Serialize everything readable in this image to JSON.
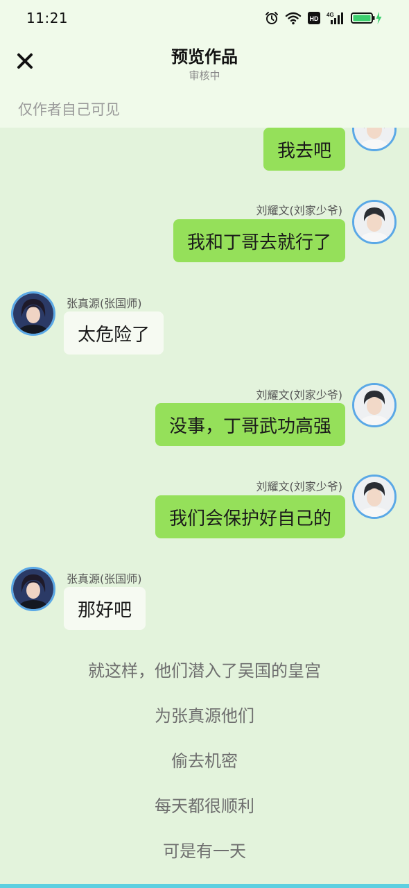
{
  "status_bar": {
    "time": "11:21",
    "icons": [
      "alarm-icon",
      "wifi-icon",
      "hd-icon",
      "signal-4g-icon",
      "battery-charging-icon"
    ],
    "battery_color": "#3ccf6e"
  },
  "header": {
    "title": "预览作品",
    "subtitle": "审核中",
    "close_icon": "close-icon"
  },
  "visibility_note": "仅作者自己可见",
  "colors": {
    "background": "#e3f3dc",
    "header_background": "#f0faea",
    "right_bubble": "#95e05a",
    "left_bubble": "#f6faf2",
    "avatar_border": "#5aa8e6",
    "bottom_strip": "#5ccfe0"
  },
  "messages": [
    {
      "side": "right",
      "sender": "",
      "text": "我去吧"
    },
    {
      "side": "right",
      "sender": "刘耀文(刘家少爷)",
      "text": "我和丁哥去就行了"
    },
    {
      "side": "left",
      "sender": "张真源(张国师)",
      "text": "太危险了"
    },
    {
      "side": "right",
      "sender": "刘耀文(刘家少爷)",
      "text": "没事，丁哥武功高强"
    },
    {
      "side": "right",
      "sender": "刘耀文(刘家少爷)",
      "text": "我们会保护好自己的"
    },
    {
      "side": "left",
      "sender": "张真源(张国师)",
      "text": "那好吧"
    }
  ],
  "narration": [
    "就这样，他们潜入了吴国的皇宫",
    "为张真源他们",
    "偷去机密",
    "每天都很顺利",
    "可是有一天"
  ]
}
